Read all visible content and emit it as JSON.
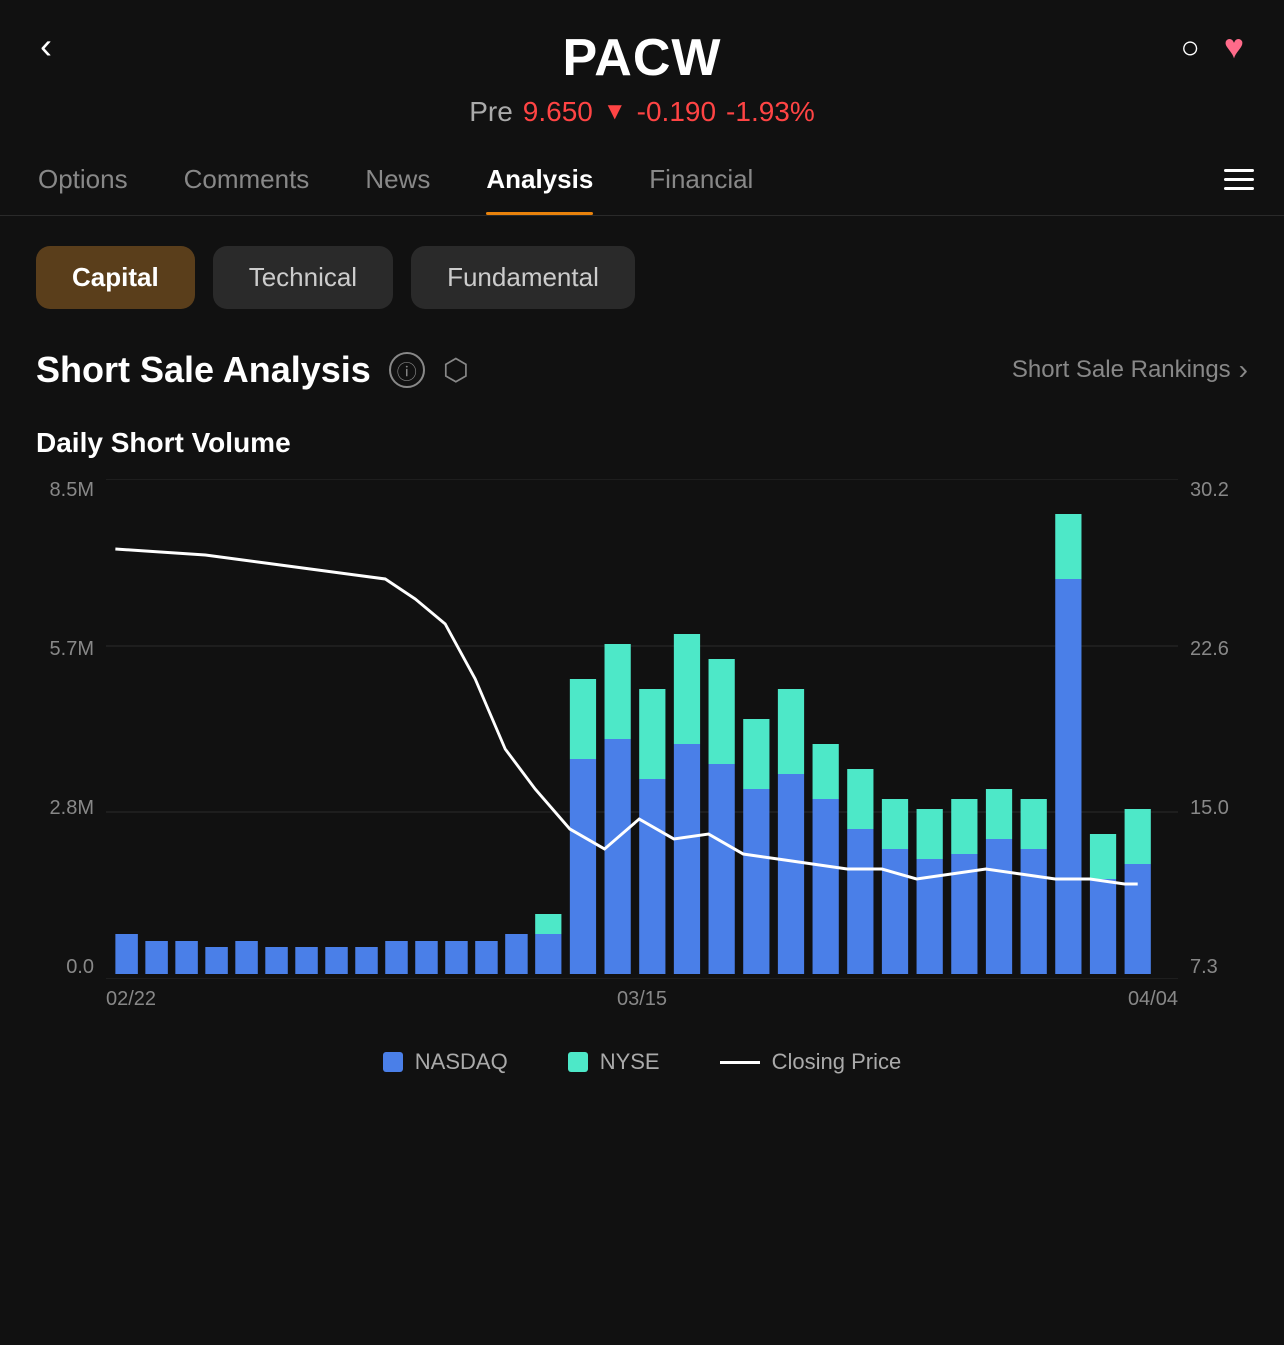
{
  "header": {
    "ticker": "PACW",
    "back_label": "‹",
    "pre_label": "Pre",
    "price": "9.650",
    "arrow": "▼",
    "change": "-0.190",
    "pct_change": "-1.93%"
  },
  "nav": {
    "tabs": [
      {
        "id": "options",
        "label": "Options",
        "active": false
      },
      {
        "id": "comments",
        "label": "Comments",
        "active": false
      },
      {
        "id": "news",
        "label": "News",
        "active": false
      },
      {
        "id": "analysis",
        "label": "Analysis",
        "active": true
      },
      {
        "id": "financial",
        "label": "Financial",
        "active": false
      }
    ],
    "menu_icon": "menu"
  },
  "sub_tabs": [
    {
      "id": "capital",
      "label": "Capital",
      "active": true
    },
    {
      "id": "technical",
      "label": "Technical",
      "active": false
    },
    {
      "id": "fundamental",
      "label": "Fundamental",
      "active": false
    }
  ],
  "section": {
    "title": "Short Sale Analysis",
    "info_icon": "ⓘ",
    "share_icon": "↗",
    "rankings_label": "Short Sale Rankings",
    "rankings_chevron": "›"
  },
  "chart": {
    "subtitle": "Daily Short Volume",
    "y_left_labels": [
      "8.5M",
      "5.7M",
      "2.8M",
      "0.0"
    ],
    "y_right_labels": [
      "30.2",
      "22.6",
      "15.0",
      "7.3"
    ],
    "x_labels": [
      "02/22",
      "03/15",
      "04/04"
    ],
    "grid_color": "#2a2a2a",
    "colors": {
      "nasdaq": "#4a7fe8",
      "nyse": "#4de8c8",
      "closing_line": "#ffffff"
    }
  },
  "legend": [
    {
      "id": "nasdaq",
      "type": "rect",
      "color": "#4a7fe8",
      "label": "NASDAQ"
    },
    {
      "id": "nyse",
      "type": "rect",
      "color": "#4de8c8",
      "label": "NYSE"
    },
    {
      "id": "closing",
      "type": "line",
      "color": "#ffffff",
      "label": "Closing Price"
    }
  ]
}
